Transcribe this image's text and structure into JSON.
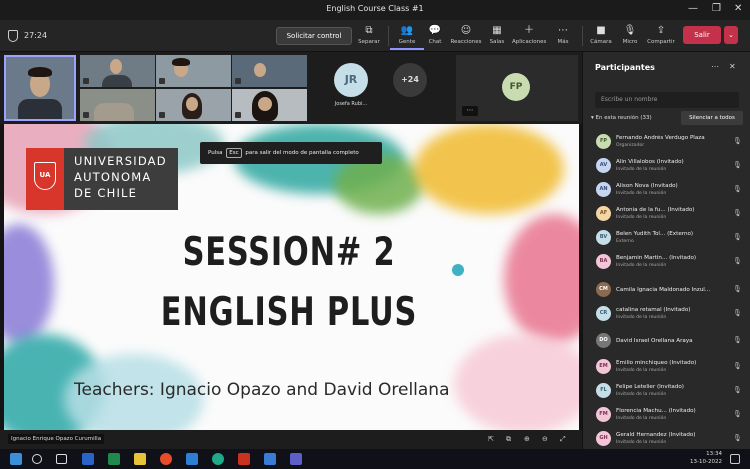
{
  "window": {
    "title": "English Course Class #1",
    "controls": [
      "—",
      "❐",
      "✕"
    ]
  },
  "toolbar": {
    "timer": "27:24",
    "request_control": "Solicitar control",
    "items": [
      {
        "icon": "share-tray-icon",
        "glyph": "⧉",
        "label": "Separar"
      },
      {
        "icon": "people-icon",
        "glyph": "👥",
        "label": "Gente"
      },
      {
        "icon": "chat-icon",
        "glyph": "💬",
        "label": "Chat"
      },
      {
        "icon": "reactions-icon",
        "glyph": "☺",
        "label": "Reacciones"
      },
      {
        "icon": "rooms-icon",
        "glyph": "▦",
        "label": "Salas"
      },
      {
        "icon": "apps-icon",
        "glyph": "＋",
        "label": "Aplicaciones"
      },
      {
        "icon": "more-icon",
        "glyph": "⋯",
        "label": "Más"
      },
      {
        "icon": "camera-icon",
        "glyph": "■",
        "label": "Cámara"
      },
      {
        "icon": "mic-icon",
        "glyph": "🎙",
        "label": "Micro"
      },
      {
        "icon": "share-icon",
        "glyph": "⇪",
        "label": "Compartir"
      }
    ],
    "leave_label": "Salir",
    "leave_chevron": "⌄"
  },
  "thumbs": {
    "jr_initials": "JR",
    "jr_name": "Josefa Rubi...",
    "overflow_count": "+24",
    "fp_initials": "FP",
    "more_dots": "⋯"
  },
  "slide": {
    "university_lines": [
      "UNIVERSIDAD",
      "AUTONOMA",
      "DE CHILE"
    ],
    "logo_mark": "UA",
    "esc_prefix": "Pulsa",
    "esc_key": "Esc",
    "esc_suffix": "para salir del modo de pantalla completo",
    "title_line1": "SESSION# 2",
    "title_line2": "ENGLISH PLUS",
    "teachers": "Teachers: Ignacio Opazo and David Orellana"
  },
  "stage_footer": {
    "presenter_name": "Ignacio Enrique Opazo Curumilla"
  },
  "panel": {
    "title": "Participantes",
    "search_placeholder": "Escribe un nombre",
    "section_label": "En esta reunión (33)",
    "mute_all": "Silenciar a todos",
    "participants": [
      {
        "initials": "FP",
        "color": "#c9dbb0",
        "fg": "#3d5a2d",
        "name": "Fernando Andrés Verdugo Plaza",
        "role": "Organizador"
      },
      {
        "initials": "AV",
        "color": "#c6d6f0",
        "fg": "#3a4f78",
        "name": "Alin Villalobos (Invitado)",
        "role": "Invitado de la reunión"
      },
      {
        "initials": "AN",
        "color": "#c6d6f0",
        "fg": "#3a4f78",
        "name": "Alison Nova (Invitado)",
        "role": "Invitado de la reunión"
      },
      {
        "initials": "AF",
        "color": "#f4d6a6",
        "fg": "#7a5520",
        "name": "Antonia de la fu... (Invitado)",
        "role": "Invitado de la reunión"
      },
      {
        "initials": "BV",
        "color": "#c6dee8",
        "fg": "#3a5f70",
        "name": "Belen Yudith Tol... (Externo)",
        "role": "Externo"
      },
      {
        "initials": "BA",
        "color": "#f2c6d6",
        "fg": "#7a3050",
        "name": "Benjamin Martin... (Invitado)",
        "role": "Invitado de la reunión"
      },
      {
        "initials": "CM",
        "color": "#8a6a50",
        "fg": "#ffffff",
        "name": "Camila Ignacia Maldonado Inzul...",
        "role": ""
      },
      {
        "initials": "CR",
        "color": "#c6dee8",
        "fg": "#3a5f70",
        "name": "catalina retamal (Invitado)",
        "role": "Invitado de la reunión"
      },
      {
        "initials": "DO",
        "color": "#777777",
        "fg": "#ffffff",
        "name": "David Israel Orellana Araya",
        "role": ""
      },
      {
        "initials": "EM",
        "color": "#f2c6d6",
        "fg": "#7a3050",
        "name": "Emilio minchiqueo (Invitado)",
        "role": "Invitado de la reunión"
      },
      {
        "initials": "FL",
        "color": "#c6dee8",
        "fg": "#3a5f70",
        "name": "Felipe Letelier (Invitado)",
        "role": "Invitado de la reunión"
      },
      {
        "initials": "FM",
        "color": "#f2c6d6",
        "fg": "#7a3050",
        "name": "Florencia Machu... (Invitado)",
        "role": "Invitado de la reunión"
      },
      {
        "initials": "GH",
        "color": "#f2c6d6",
        "fg": "#7a3050",
        "name": "Gerald Hernandez (Invitado)",
        "role": "Invitado de la reunión"
      }
    ]
  },
  "taskbar": {
    "time": "13:34",
    "date": "13-10-2022"
  }
}
